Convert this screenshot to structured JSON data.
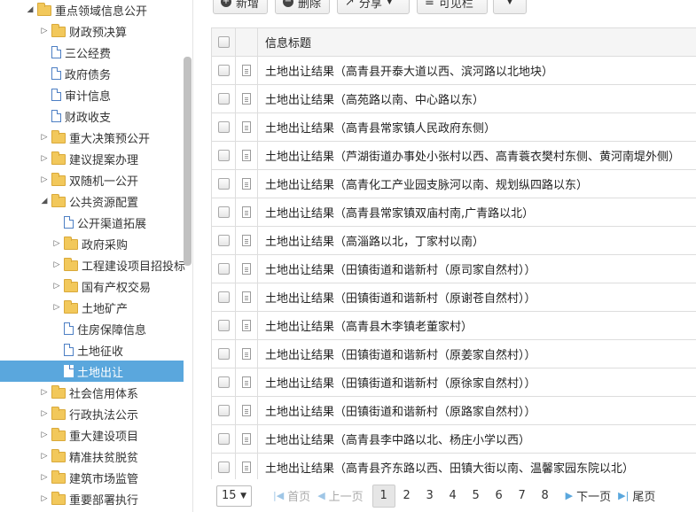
{
  "tree": {
    "items": [
      {
        "label": "重点领域信息公开",
        "kind": "folder",
        "state": "open"
      },
      {
        "label": "财政预决算",
        "kind": "folder",
        "state": "closed"
      },
      {
        "label": "三公经费",
        "kind": "doc"
      },
      {
        "label": "政府债务",
        "kind": "doc"
      },
      {
        "label": "审计信息",
        "kind": "doc"
      },
      {
        "label": "财政收支",
        "kind": "doc"
      },
      {
        "label": "重大决策预公开",
        "kind": "folder",
        "state": "closed"
      },
      {
        "label": "建议提案办理",
        "kind": "folder",
        "state": "closed"
      },
      {
        "label": "双随机一公开",
        "kind": "folder",
        "state": "closed"
      },
      {
        "label": "公共资源配置",
        "kind": "folder",
        "state": "open"
      },
      {
        "label": "公开渠道拓展",
        "kind": "doc"
      },
      {
        "label": "政府采购",
        "kind": "folder",
        "state": "closed"
      },
      {
        "label": "工程建设项目招投标",
        "kind": "folder",
        "state": "closed"
      },
      {
        "label": "国有产权交易",
        "kind": "folder",
        "state": "closed"
      },
      {
        "label": "土地矿产",
        "kind": "folder",
        "state": "closed"
      },
      {
        "label": "住房保障信息",
        "kind": "doc"
      },
      {
        "label": "土地征收",
        "kind": "doc"
      },
      {
        "label": "土地出让",
        "kind": "doc",
        "selected": true
      },
      {
        "label": "社会信用体系",
        "kind": "folder",
        "state": "closed"
      },
      {
        "label": "行政执法公示",
        "kind": "folder",
        "state": "closed"
      },
      {
        "label": "重大建设项目",
        "kind": "folder",
        "state": "closed"
      },
      {
        "label": "精准扶贫脱贫",
        "kind": "folder",
        "state": "closed"
      },
      {
        "label": "建筑市场监管",
        "kind": "folder",
        "state": "closed"
      },
      {
        "label": "重要部署执行",
        "kind": "folder",
        "state": "closed"
      }
    ]
  },
  "toolbar": {
    "add_label": "新增",
    "delete_label": "删除",
    "share_label": "分享",
    "visible_label": "可见栏"
  },
  "grid": {
    "header_title": "信息标题",
    "rows": [
      "土地出让结果（高青县开泰大道以西、滨河路以北地块）",
      "土地出让结果（高苑路以南、中心路以东）",
      "土地出让结果（高青县常家镇人民政府东侧）",
      "土地出让结果（芦湖街道办事处小张村以西、高青蓑衣樊村东侧、黄河南堤外侧）",
      "土地出让结果（高青化工产业园支脉河以南、规划纵四路以东）",
      "土地出让结果（高青县常家镇双庙村南,广青路以北）",
      "土地出让结果（高淄路以北，丁家村以南）",
      "土地出让结果（田镇街道和谐新村（原司家自然村））",
      "土地出让结果（田镇街道和谐新村（原谢苍自然村））",
      "土地出让结果（高青县木李镇老董家村）",
      "土地出让结果（田镇街道和谐新村（原姜家自然村））",
      "土地出让结果（田镇街道和谐新村（原徐家自然村））",
      "土地出让结果（田镇街道和谐新村（原路家自然村））",
      "土地出让结果（高青县李中路以北、杨庄小学以西）",
      "土地出让结果（高青县齐东路以西、田镇大街以南、温馨家园东院以北）"
    ]
  },
  "pager": {
    "page_size": "15",
    "first_label": "首页",
    "prev_label": "上一页",
    "pages": [
      "1",
      "2",
      "3",
      "4",
      "5",
      "6",
      "7",
      "8"
    ],
    "current_page": "1",
    "next_label": "下一页",
    "last_label": "尾页"
  }
}
